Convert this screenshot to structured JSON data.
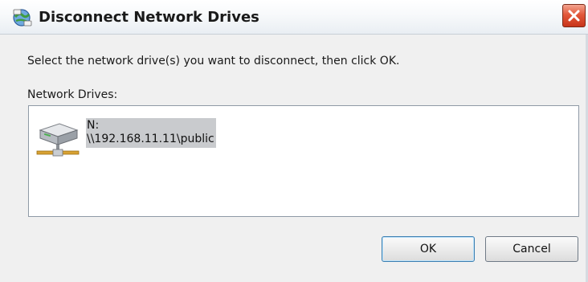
{
  "window": {
    "title": "Disconnect Network Drives",
    "title_icon": "network-drive-disconnect-icon",
    "close_icon": "close-icon"
  },
  "dialog": {
    "instruction": "Select the network drive(s) you want to disconnect, then click OK.",
    "list_label": "Network Drives:",
    "drives": [
      {
        "letter": "N:",
        "path": "\\\\192.168.11.11\\public",
        "icon": "network-drive-icon",
        "selected": true
      }
    ]
  },
  "buttons": {
    "ok_label": "OK",
    "cancel_label": "Cancel"
  },
  "colors": {
    "selection": "#c9cbce",
    "close_button": "#e2583a"
  }
}
